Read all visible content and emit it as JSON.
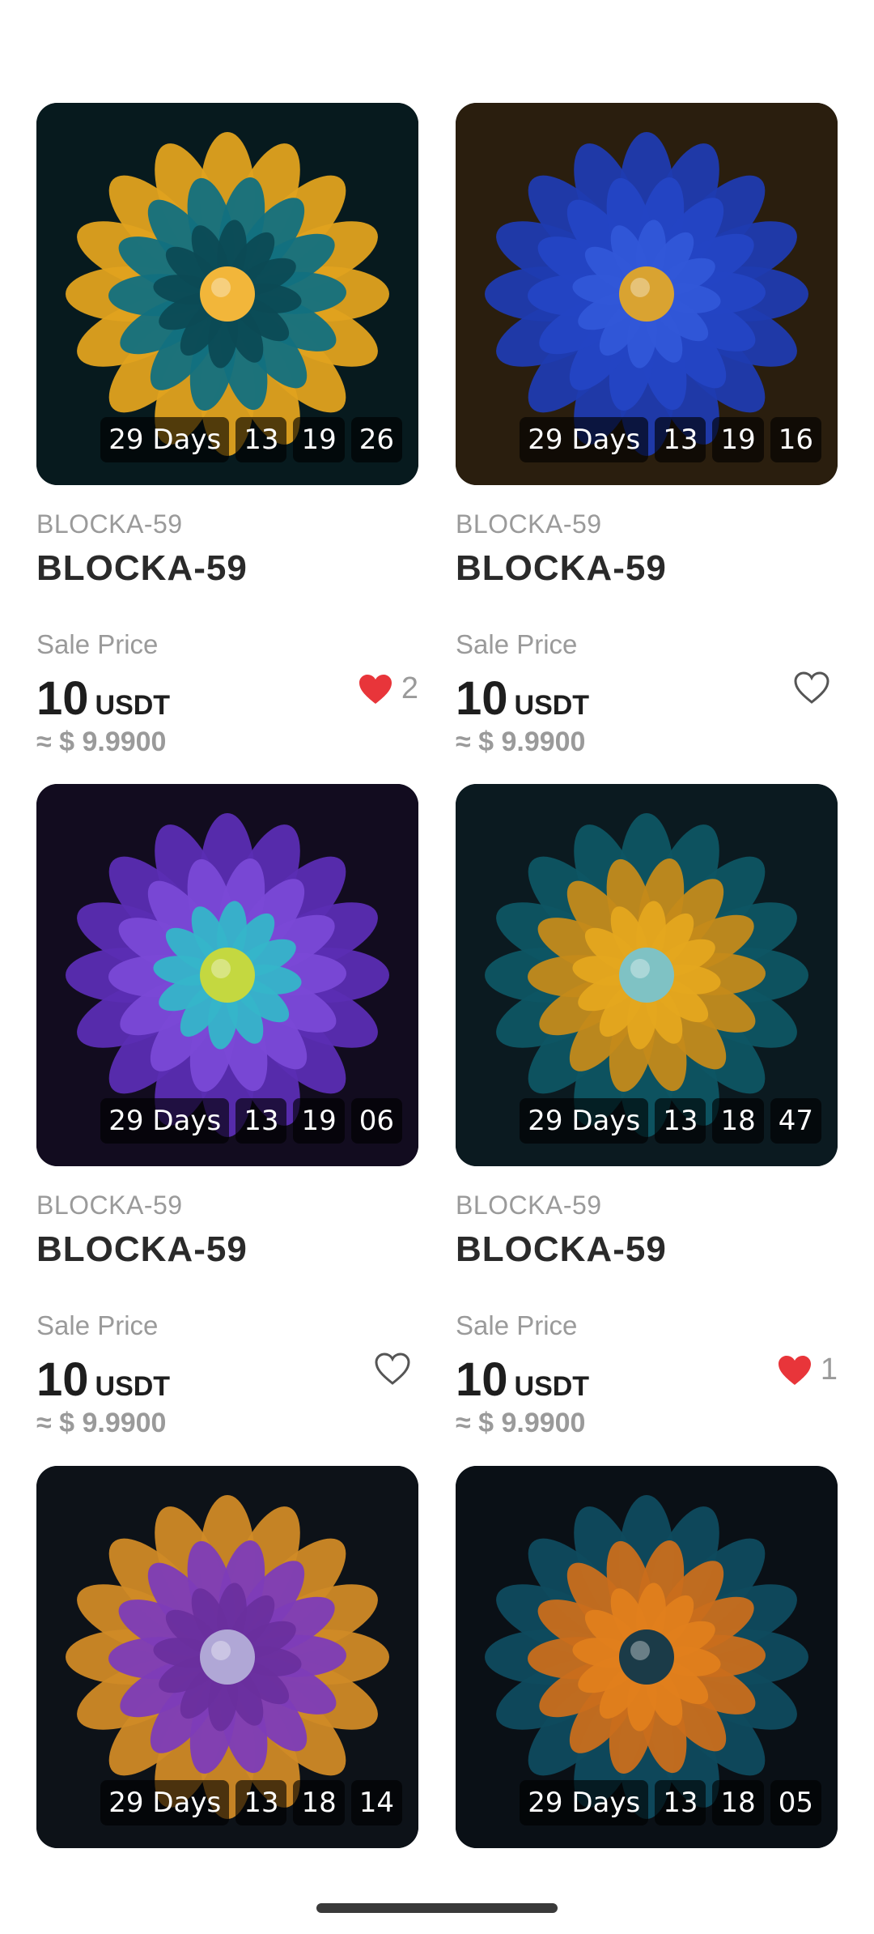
{
  "cards": [
    {
      "subtitle": "BLOCKA-59",
      "title": "BLOCKA-59",
      "sale_label": "Sale Price",
      "price": "10",
      "unit": "USDT",
      "approx": "≈ $ 9.9900",
      "timer": {
        "days": "29 Days",
        "h": "13",
        "m": "19",
        "s": "26"
      },
      "liked": true,
      "likes": "2",
      "art": {
        "bg": "#071a1e",
        "outer": "#e0a21f",
        "inner": "#0c4a55",
        "center": "#f2b63a",
        "petals": "#127080"
      }
    },
    {
      "subtitle": "BLOCKA-59",
      "title": "BLOCKA-59",
      "sale_label": "Sale Price",
      "price": "10",
      "unit": "USDT",
      "approx": "≈ $ 9.9900",
      "timer": {
        "days": "29 Days",
        "h": "13",
        "m": "19",
        "s": "16"
      },
      "liked": false,
      "likes": "",
      "art": {
        "bg": "#2a1e0e",
        "outer": "#1f3bb0",
        "inner": "#3157d8",
        "center": "#d9a331",
        "petals": "#2444c4"
      }
    },
    {
      "subtitle": "BLOCKA-59",
      "title": "BLOCKA-59",
      "sale_label": "Sale Price",
      "price": "10",
      "unit": "USDT",
      "approx": "≈ $ 9.9900",
      "timer": {
        "days": "29 Days",
        "h": "13",
        "m": "19",
        "s": "06"
      },
      "liked": false,
      "likes": "",
      "art": {
        "bg": "#120c1f",
        "outer": "#5b2db3",
        "inner": "#35b5c9",
        "center": "#c4d840",
        "petals": "#7a49d6"
      }
    },
    {
      "subtitle": "BLOCKA-59",
      "title": "BLOCKA-59",
      "sale_label": "Sale Price",
      "price": "10",
      "unit": "USDT",
      "approx": "≈ $ 9.9900",
      "timer": {
        "days": "29 Days",
        "h": "13",
        "m": "18",
        "s": "47"
      },
      "liked": true,
      "likes": "1",
      "art": {
        "bg": "#0b1a20",
        "outer": "#0e5563",
        "inner": "#e4a61f",
        "center": "#7fc2c4",
        "petals": "#c48a1a"
      }
    },
    {
      "subtitle": "BLOCKA-59",
      "title": "BLOCKA-59",
      "sale_label": "Sale Price",
      "price": "10",
      "unit": "USDT",
      "approx": "≈ $ 9.9900",
      "timer": {
        "days": "29 Days",
        "h": "13",
        "m": "18",
        "s": "14"
      },
      "liked": false,
      "likes": "",
      "art": {
        "bg": "#0d1218",
        "outer": "#d08a26",
        "inner": "#6a2f9e",
        "center": "#b0a7d6",
        "petals": "#7d3cb8"
      }
    },
    {
      "subtitle": "BLOCKA-59",
      "title": "BLOCKA-59",
      "sale_label": "Sale Price",
      "price": "10",
      "unit": "USDT",
      "approx": "≈ $ 9.9900",
      "timer": {
        "days": "29 Days",
        "h": "13",
        "m": "18",
        "s": "05"
      },
      "liked": false,
      "likes": "",
      "art": {
        "bg": "#0a1016",
        "outer": "#0f4b5e",
        "inner": "#e0801c",
        "center": "#1b3b48",
        "petals": "#c96e1c"
      }
    }
  ],
  "colors": {
    "heart_active": "#e8353a",
    "heart_outline": "#555555",
    "muted": "#9a9a9a"
  }
}
